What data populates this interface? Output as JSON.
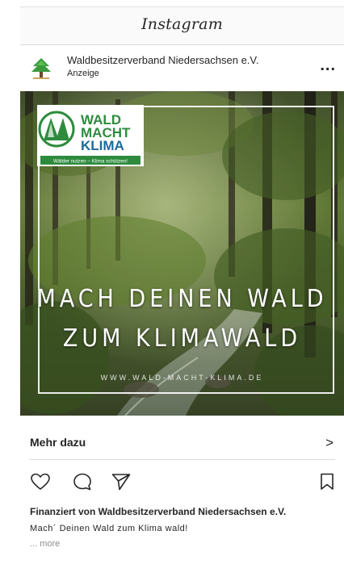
{
  "app": {
    "title": "Instagram"
  },
  "post": {
    "account_name": "Waldbesitzerverband Niedersachsen e.V.",
    "sponsored_label": "Anzeige",
    "more_label": "...",
    "image": {
      "logo_line1": "WALD",
      "logo_line2": "MACHT",
      "logo_line3": "KLIMA",
      "logo_tagline": "Wälder nutzen – Klima schützen!",
      "headline_line1": "MACH DEINEN WALD",
      "headline_line2": "ZUM KLIMAWALD",
      "website": "WWW.WALD-MACHT-KLIMA.DE"
    },
    "cta": {
      "label": "Mehr dazu",
      "chevron": ">"
    },
    "actions": [
      "heart-icon",
      "comment-icon",
      "share-icon",
      "bookmark-icon"
    ],
    "sponsored_by": "Finanziert von Waldbesitzerverband Niedersachsen e.V.",
    "caption": "Mach´ Deinen Wald zum Klima wald!",
    "caption_more": "... more"
  },
  "colors": {
    "text": "#262626",
    "muted": "#8e8e8e",
    "border": "#dbdbdb",
    "header_bg": "#fafafa",
    "logo_green": "#2e8b3e"
  }
}
